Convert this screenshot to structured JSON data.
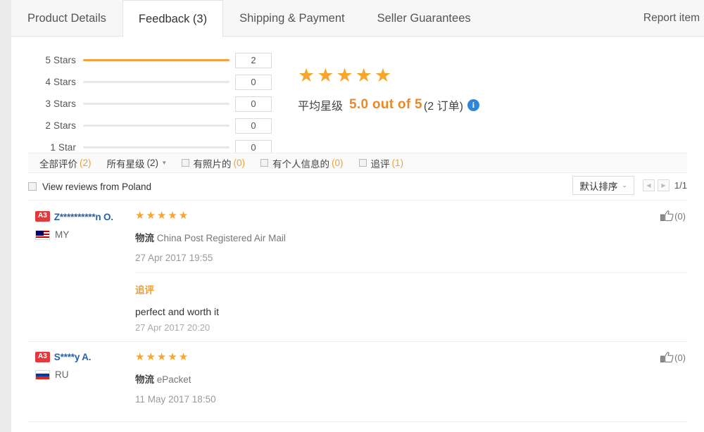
{
  "tabs": [
    {
      "label": "Product Details",
      "active": false
    },
    {
      "label": "Feedback (3)",
      "active": true
    },
    {
      "label": "Shipping & Payment",
      "active": false
    },
    {
      "label": "Seller Guarantees",
      "active": false
    }
  ],
  "report_item": "Report item",
  "rating_breakdown": {
    "rows": [
      {
        "label": "5 Stars",
        "count": "2",
        "percent": 100
      },
      {
        "label": "4 Stars",
        "count": "0",
        "percent": 0
      },
      {
        "label": "3 Stars",
        "count": "0",
        "percent": 0
      },
      {
        "label": "2 Stars",
        "count": "0",
        "percent": 0
      },
      {
        "label": "1 Star",
        "count": "0",
        "percent": 0
      }
    ]
  },
  "average": {
    "stars_glyphs": "★★★★★",
    "label_cn": "平均星级",
    "value_text": "5.0 out of 5",
    "orders_text": "(2 订单)",
    "info_icon": "i",
    "accent_color": "#e8892a"
  },
  "filters": [
    {
      "name": "all-reviews",
      "label": "全部评价",
      "count": "(2)",
      "checkbox": false,
      "caret": false
    },
    {
      "name": "all-stars",
      "label": "所有星级",
      "count": "(2)",
      "checkbox": false,
      "caret": true
    },
    {
      "name": "with-photos",
      "label": "有照片的",
      "count": "(0)",
      "checkbox": true,
      "caret": false
    },
    {
      "name": "with-personal-info",
      "label": "有个人信息的",
      "count": "(0)",
      "checkbox": true,
      "caret": false
    },
    {
      "name": "follow-up",
      "label": "追评",
      "count": "(1)",
      "checkbox": true,
      "caret": false
    }
  ],
  "sortbar": {
    "poland_label": "View reviews from Poland",
    "sort_label": "默认排序",
    "sort_caret": "⌄",
    "prev_arrow": "◀",
    "next_arrow": "▶",
    "page_indicator": "1/1"
  },
  "reviews": [
    {
      "badge": "A3",
      "username": "Z**********n O.",
      "name_stacked": true,
      "country_code": "MY",
      "flag": "flag-my",
      "stars": "★★★★★",
      "logistics_label": "物流",
      "logistics_value": "China Post Registered Air Mail",
      "date": "27 Apr 2017 19:55",
      "like_count": "(0)",
      "followup": {
        "title": "追评",
        "text": "perfect and worth it",
        "date": "27 Apr 2017 20:20"
      }
    },
    {
      "badge": "A3",
      "username": "S****y A.",
      "name_stacked": false,
      "country_code": "RU",
      "flag": "flag-ru",
      "stars": "★★★★★",
      "logistics_label": "物流",
      "logistics_value": "ePacket",
      "date": "11 May 2017 18:50",
      "like_count": "(0)",
      "followup": null
    }
  ]
}
